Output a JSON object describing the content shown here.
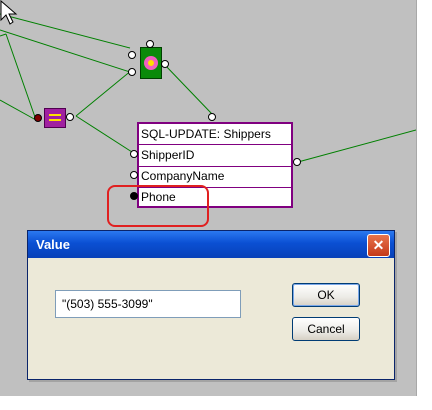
{
  "node": {
    "title": "SQL-UPDATE: Shippers",
    "fields": [
      "ShipperID",
      "CompanyName",
      "Phone"
    ]
  },
  "dialog": {
    "title": "Value",
    "close_symbol": "✕",
    "value": "\"(503) 555-3099\"",
    "ok_label": "OK",
    "cancel_label": "Cancel"
  },
  "colors": {
    "canvas": "#c0c0c0",
    "wire": "#008000",
    "node_border": "#800080",
    "highlight": "#e02020",
    "titlebar": "#0a4fd3"
  }
}
